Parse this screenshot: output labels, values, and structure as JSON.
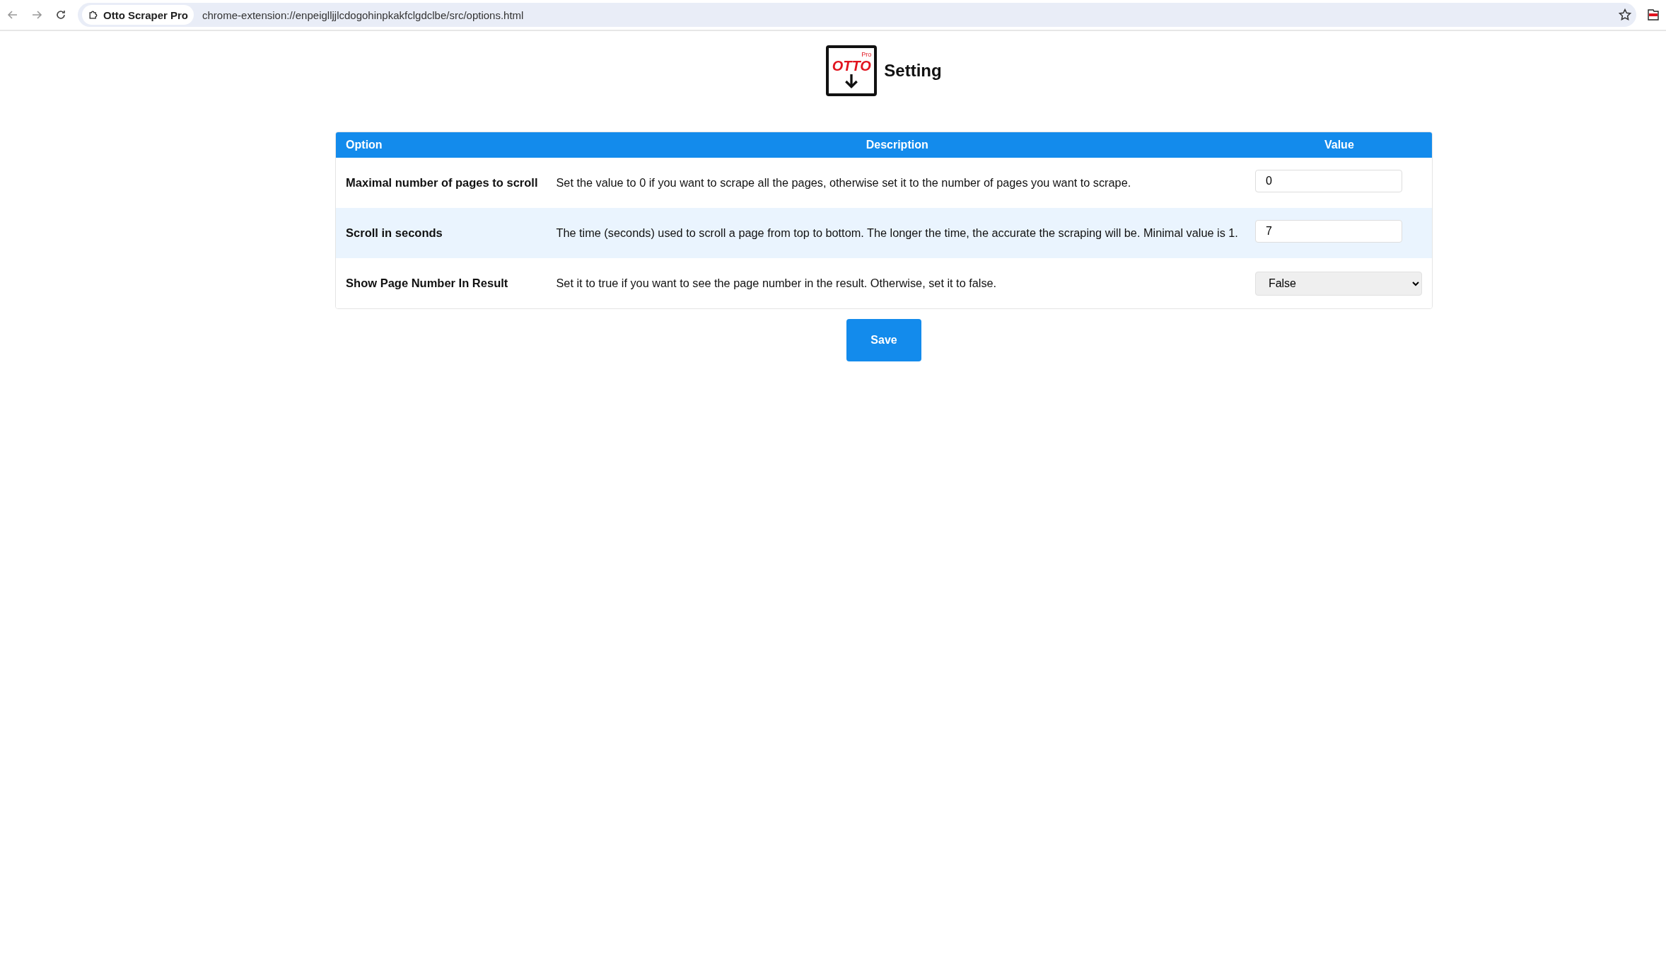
{
  "browser": {
    "site_name": "Otto Scraper Pro",
    "url": "chrome-extension://enpeiglljjlcdogohinpkakfclgdclbe/src/options.html"
  },
  "header": {
    "logo_text": "OTTO",
    "logo_badge": "Pro",
    "title": "Setting"
  },
  "table": {
    "columns": [
      "Option",
      "Description",
      "Value"
    ],
    "rows": [
      {
        "option": "Maximal number of pages to scroll",
        "description": "Set the value to 0 if you want to scrape all the pages, otherwise set it to the number of pages you want to scrape.",
        "kind": "input",
        "value": "0"
      },
      {
        "option": "Scroll in seconds",
        "description": "The time (seconds) used to scroll a page from top to bottom. The longer the time, the accurate the scraping will be. Minimal value is 1.",
        "kind": "input",
        "value": "7"
      },
      {
        "option": "Show Page Number In Result",
        "description": "Set it to true if you want to see the page number in the result. Otherwise, set it to false.",
        "kind": "select",
        "value": "False"
      }
    ]
  },
  "save_button": "Save"
}
